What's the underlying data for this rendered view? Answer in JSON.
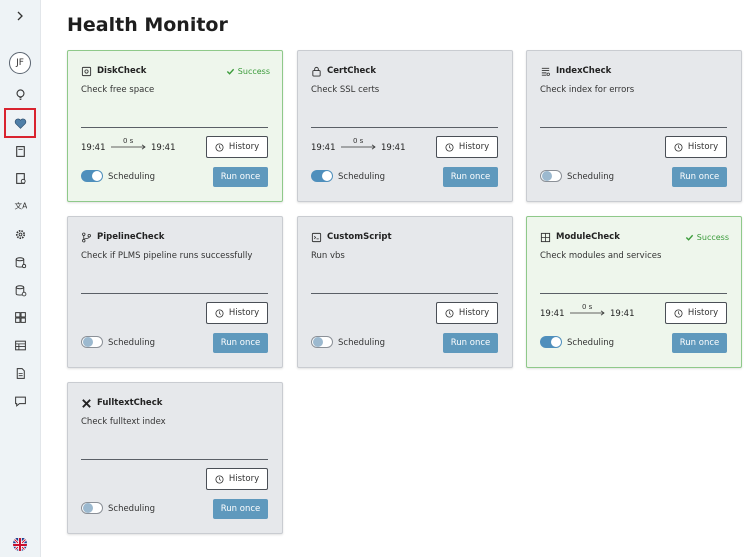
{
  "page": {
    "title": "Health Monitor"
  },
  "sidebar": {
    "user_initials": "JF"
  },
  "labels": {
    "history": "History",
    "scheduling": "Scheduling",
    "run_once": "Run once",
    "success": "Success"
  },
  "cards": [
    {
      "name": "DiskCheck",
      "description": "Check free space",
      "status": "Success",
      "start": "19:41",
      "end": "19:41",
      "duration": "0 s",
      "scheduling": true
    },
    {
      "name": "CertCheck",
      "description": "Check SSL certs",
      "status": "",
      "start": "19:41",
      "end": "19:41",
      "duration": "0 s",
      "scheduling": true
    },
    {
      "name": "IndexCheck",
      "description": "Check index for errors",
      "status": "",
      "start": "",
      "end": "",
      "duration": "",
      "scheduling": false
    },
    {
      "name": "PipelineCheck",
      "description": "Check if PLMS pipeline runs successfully",
      "status": "",
      "start": "",
      "end": "",
      "duration": "",
      "scheduling": false
    },
    {
      "name": "CustomScript",
      "description": "Run vbs",
      "status": "",
      "start": "",
      "end": "",
      "duration": "",
      "scheduling": false
    },
    {
      "name": "ModuleCheck",
      "description": "Check modules and services",
      "status": "Success",
      "start": "19:41",
      "end": "19:41",
      "duration": "0 s",
      "scheduling": true
    },
    {
      "name": "FulltextCheck",
      "description": "Check fulltext index",
      "status": "",
      "start": "",
      "end": "",
      "duration": "",
      "scheduling": false
    }
  ],
  "colors": {
    "accent": "#5f99bd",
    "success": "#3a9b3a",
    "active_outline": "#d9232f"
  }
}
